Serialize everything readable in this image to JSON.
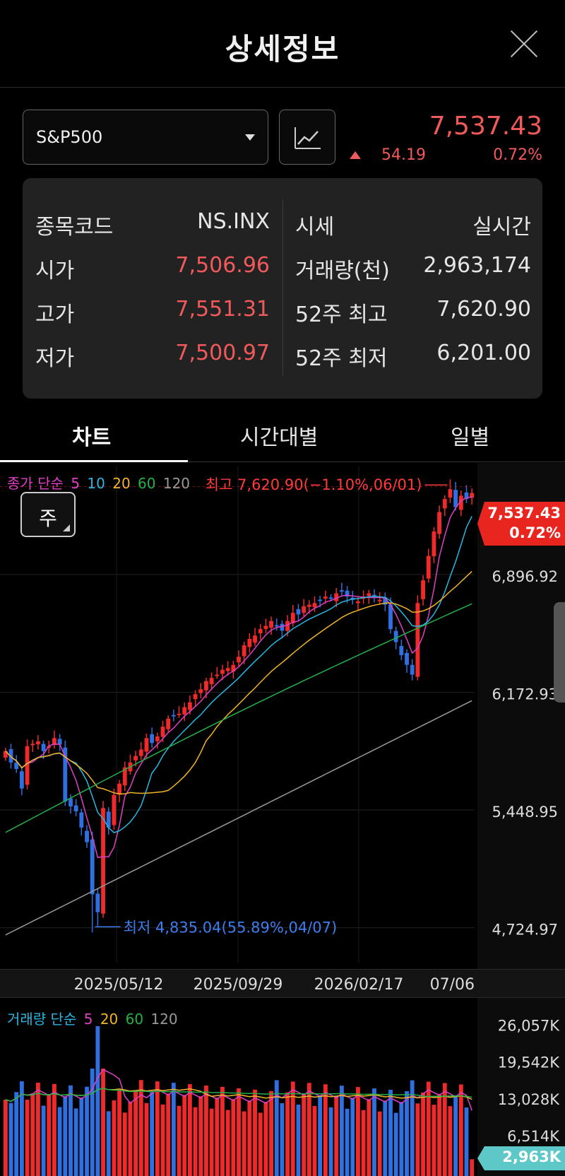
{
  "header": {
    "title": "상세정보"
  },
  "symbol": {
    "name": "S&P500"
  },
  "quote": {
    "price": "7,537.43",
    "change": "54.19",
    "change_pct": "0.72%",
    "direction": "up",
    "color_up": "#f05a5a"
  },
  "info": {
    "left": [
      {
        "label": "종목코드",
        "value": "NS.INX",
        "red": false
      },
      {
        "label": "시가",
        "value": "7,506.96",
        "red": true
      },
      {
        "label": "고가",
        "value": "7,551.31",
        "red": true
      },
      {
        "label": "저가",
        "value": "7,500.97",
        "red": true
      }
    ],
    "right": [
      {
        "label": "시세",
        "value": "실시간"
      },
      {
        "label": "거래량(천)",
        "value": "2,963,174"
      },
      {
        "label": "52주 최고",
        "value": "7,620.90"
      },
      {
        "label": "52주 최저",
        "value": "6,201.00"
      }
    ]
  },
  "tabs": [
    {
      "label": "차트",
      "active": true
    },
    {
      "label": "시간대별",
      "active": false
    },
    {
      "label": "일별",
      "active": false
    }
  ],
  "period_button": {
    "label": "주"
  },
  "legend": {
    "prefix": "종가 단순",
    "items": [
      {
        "label": "5",
        "color": "#e040c8"
      },
      {
        "label": "10",
        "color": "#29b6e0"
      },
      {
        "label": "20",
        "color": "#f0b429"
      },
      {
        "label": "60",
        "color": "#22b04a"
      },
      {
        "label": "120",
        "color": "#999999"
      }
    ],
    "prefix_color": "#e040c8"
  },
  "volume_legend": {
    "prefix": "거래량 단순",
    "items": [
      {
        "label": "5",
        "color": "#e040c8"
      },
      {
        "label": "20",
        "color": "#f0b429"
      },
      {
        "label": "60",
        "color": "#22b04a"
      },
      {
        "label": "120",
        "color": "#999999"
      }
    ],
    "prefix_color": "#29b6e0"
  },
  "annotations": {
    "high": "최고 7,620.90(−1.10%,06/01)",
    "low": "최저 4,835.04(55.89%,04/07)",
    "high_color": "#ff3b3b",
    "low_color": "#3d7df0"
  },
  "price_tag": {
    "price": "7,537.43",
    "pct": "0.72%",
    "color": "#e8261f"
  },
  "volume_tag": {
    "value": "2,963K",
    "color": "#5ec8c8"
  },
  "chart_data": {
    "type": "candlestick",
    "interval": "weekly",
    "y_ticks": [
      "6,896.92",
      "6,172.93",
      "5,448.95",
      "4,724.97"
    ],
    "y_tick_values": [
      6896.92,
      6172.93,
      5448.95,
      4724.97
    ],
    "ylim": [
      4650,
      7700
    ],
    "x_ticks": [
      "2025/05/12",
      "2025/09/29",
      "2026/02/17",
      "07/06"
    ],
    "last_price": 7537.43,
    "high": 7620.9,
    "low": 4835.04,
    "closes": [
      5950,
      5880,
      5840,
      5720,
      5980,
      5995,
      6010,
      5950,
      5980,
      6030,
      5990,
      5640,
      5610,
      5580,
      5480,
      5390,
      5070,
      4960,
      5600,
      5480,
      5680,
      5750,
      5850,
      5880,
      5920,
      5960,
      6030,
      6000,
      6040,
      6100,
      6150,
      6170,
      6180,
      6220,
      6250,
      6300,
      6330,
      6380,
      6400,
      6420,
      6450,
      6460,
      6480,
      6530,
      6600,
      6640,
      6660,
      6700,
      6720,
      6750,
      6720,
      6690,
      6750,
      6800,
      6790,
      6840,
      6850,
      6860,
      6880,
      6900,
      6890,
      6920,
      6930,
      6900,
      6880,
      6870,
      6900,
      6920,
      6900,
      6880,
      6850,
      6700,
      6620,
      6540,
      6480,
      6420,
      6860,
      7000,
      7150,
      7300,
      7420,
      7500,
      7560,
      7450,
      7520,
      7500,
      7537
    ],
    "volume_y_ticks": [
      "26,057K",
      "19,542K",
      "13,028K",
      "6,514K"
    ],
    "volume_y_tick_values": [
      26057,
      19542,
      13028,
      6514
    ],
    "volume_last": "2,963K"
  }
}
